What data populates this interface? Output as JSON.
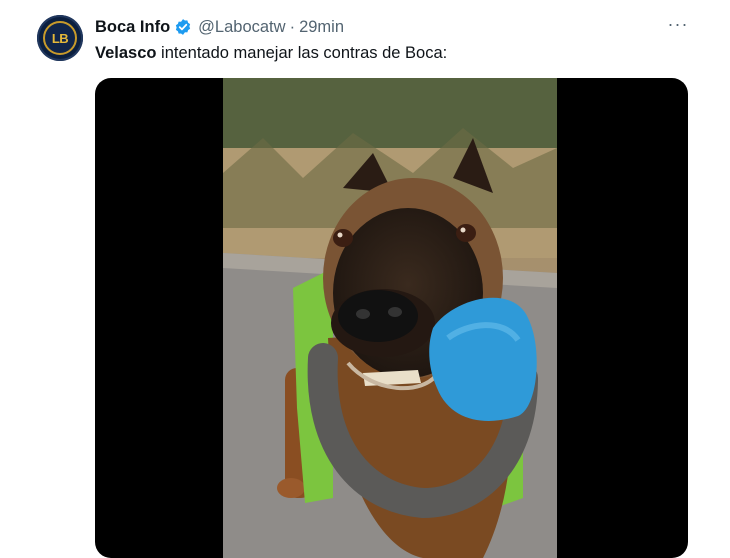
{
  "account": {
    "display_name": "Boca Info",
    "handle": "@Labocatw",
    "separator": "·",
    "time": "29min",
    "avatar_initials": "LB",
    "verified": true
  },
  "tweet": {
    "mention_bold": "Velasco",
    "text_rest": " intentado manejar las contras de Boca:"
  },
  "menu": {
    "more_glyph": "···"
  },
  "media": {
    "kind": "video",
    "subject": "dog holding a blue toy"
  },
  "colors": {
    "verified_badge": "#1d9bf0",
    "secondary_text": "#536471",
    "primary_text": "#0f1419",
    "media_background": "#000000"
  },
  "icons": [
    "verified-badge-icon",
    "more-options-icon"
  ]
}
